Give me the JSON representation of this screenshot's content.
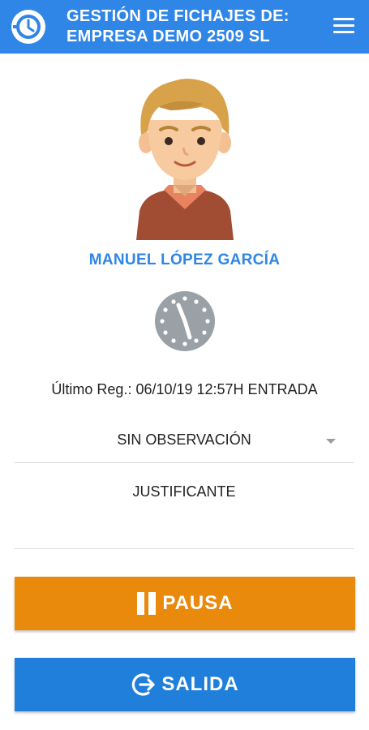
{
  "header": {
    "title_line1": "GESTIÓN DE FICHAJES DE:",
    "title_line2": "EMPRESA DEMO 2509 SL",
    "logo_icon": "clock-logo-icon",
    "menu_icon": "hamburger-menu-icon"
  },
  "employee": {
    "name": "MANUEL LÓPEZ GARCÍA",
    "avatar_icon": "user-avatar-illustration"
  },
  "status": {
    "clock_icon": "clock-icon",
    "last_record": "Último Reg.: 06/10/19 12:57H ENTRADA"
  },
  "form": {
    "observation_selected": "SIN OBSERVACIÓN",
    "justificante_label": "JUSTIFICANTE"
  },
  "actions": {
    "pause_label": "PAUSA",
    "exit_label": "SALIDA"
  },
  "colors": {
    "primary": "#2f86e6",
    "pause": "#e98a0c",
    "exit": "#1f7fdb"
  }
}
